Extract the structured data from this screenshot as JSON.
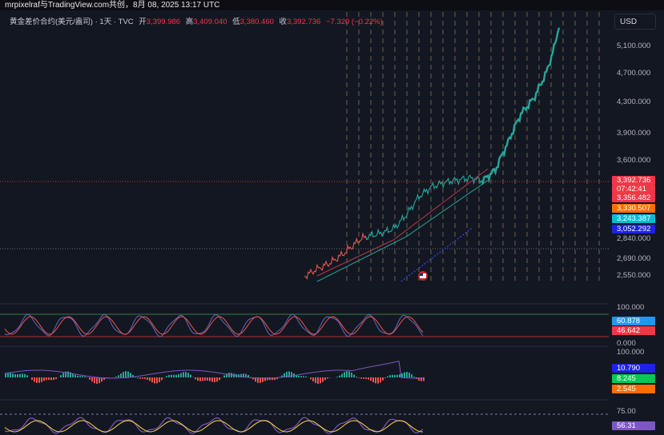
{
  "watermark": "mrpixelraf与TradingView.com共创，8月 08, 2025 13:17 UTC",
  "legend": {
    "symbol": "黄金差价合约(美元/盎司) · 1天 · TVC",
    "open_label": "开",
    "open": "3,399.986",
    "high_label": "高",
    "high": "3,409.040",
    "low_label": "低",
    "low": "3,380.460",
    "close_label": "收",
    "close": "3,392.736",
    "change": "−7.320 (−0.22%)"
  },
  "currency": "USD",
  "price_axis": [
    "5,100.000",
    "4,700.000",
    "4,300.000",
    "3,900.000",
    "3,600.000",
    "2,840.000",
    "2,690.000",
    "2,550.000"
  ],
  "price_tags": [
    {
      "text": "3,392.736",
      "color": "#f23645"
    },
    {
      "text": "07:42:41",
      "color": "#f23645"
    },
    {
      "text": "3,356.482",
      "color": "#f23645"
    },
    {
      "text": "3,330.507",
      "color": "#ff6d00"
    },
    {
      "text": "3,243.387",
      "color": "#00bcd4"
    },
    {
      "text": "3,052.292",
      "color": "#1e22e6"
    }
  ],
  "stoch": {
    "axis": [
      "100.000",
      "0.000"
    ],
    "tags": [
      {
        "text": "60.878",
        "color": "#2196f3"
      },
      {
        "text": "46.642",
        "color": "#f23645"
      }
    ]
  },
  "macd": {
    "axis": [
      "100.000"
    ],
    "tags": [
      {
        "text": "10.790",
        "color": "#1e22e6"
      },
      {
        "text": "8.245",
        "color": "#00c853"
      },
      {
        "text": "2.545",
        "color": "#ff6d00"
      }
    ]
  },
  "rsi": {
    "axis": [
      "75.00"
    ],
    "tags": [
      {
        "text": "56.31",
        "color": "#7e57c2"
      }
    ]
  },
  "colors": {
    "background": "#131722",
    "bull": "#26a69a",
    "bear": "#ef5350",
    "vgrid": "#8a7a3a"
  },
  "chart_data": {
    "type": "line",
    "series": [
      {
        "x": [
          0,
          5,
          10,
          15,
          20,
          25,
          30,
          35,
          40,
          45,
          50,
          55,
          60,
          65,
          70,
          75,
          80,
          85,
          90,
          95,
          100
        ],
        "values": [
          2540,
          2600,
          2650,
          2720,
          2800,
          2880,
          2950,
          3050,
          3150,
          3280,
          3350,
          3380,
          3400,
          3420,
          3392.736,
          3500,
          3800,
          4150,
          4350,
          4700,
          5300
        ]
      }
    ],
    "ylim": [
      2500,
      5400
    ]
  }
}
